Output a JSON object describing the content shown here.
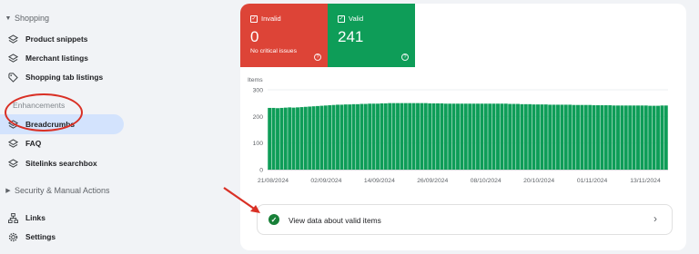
{
  "sidebar": {
    "shopping_header": "Shopping",
    "shopping_items": [
      {
        "label": "Product snippets",
        "icon": "layers-icon"
      },
      {
        "label": "Merchant listings",
        "icon": "layers-icon"
      },
      {
        "label": "Shopping tab listings",
        "icon": "tag-icon"
      }
    ],
    "enhancements_label": "Enhancements",
    "enhancement_items": [
      {
        "label": "Breadcrumbs",
        "icon": "layers-icon",
        "active": true
      },
      {
        "label": "FAQ",
        "icon": "layers-icon"
      },
      {
        "label": "Sitelinks searchbox",
        "icon": "layers-icon"
      }
    ],
    "security_header": "Security & Manual Actions",
    "bottom_items": [
      {
        "label": "Links",
        "icon": "sitemap-icon"
      },
      {
        "label": "Settings",
        "icon": "gear-icon"
      }
    ]
  },
  "tiles": {
    "invalid": {
      "label": "Invalid",
      "value": "0",
      "subtext": "No critical issues",
      "color": "#dd4437"
    },
    "valid": {
      "label": "Valid",
      "value": "241",
      "color": "#0e9d58"
    }
  },
  "chart_data": {
    "type": "bar",
    "ylabel": "Items",
    "ylim": [
      0,
      300
    ],
    "yticks": [
      "300",
      "200",
      "100",
      "0"
    ],
    "x_tick_labels": [
      "21/08/2024",
      "02/09/2024",
      "14/09/2024",
      "26/09/2024",
      "08/10/2024",
      "20/10/2024",
      "01/11/2024",
      "13/11/2024"
    ],
    "color": "#0e9d58",
    "values": [
      232,
      232,
      231,
      232,
      233,
      234,
      233,
      234,
      235,
      236,
      237,
      238,
      239,
      240,
      241,
      242,
      243,
      244,
      244,
      245,
      245,
      246,
      246,
      247,
      247,
      248,
      248,
      248,
      249,
      249,
      250,
      250,
      250,
      250,
      250,
      250,
      250,
      250,
      250,
      250,
      249,
      249,
      249,
      249,
      248,
      248,
      248,
      248,
      248,
      248,
      248,
      248,
      248,
      248,
      248,
      248,
      248,
      248,
      248,
      248,
      247,
      247,
      247,
      246,
      246,
      246,
      245,
      245,
      245,
      245,
      244,
      244,
      244,
      244,
      244,
      244,
      243,
      243,
      243,
      243,
      243,
      242,
      242,
      242,
      242,
      242,
      241,
      241,
      241,
      241,
      241,
      241,
      241,
      241,
      241,
      240,
      240,
      240,
      241,
      241
    ]
  },
  "valid_row": {
    "text": "View data about valid items"
  }
}
